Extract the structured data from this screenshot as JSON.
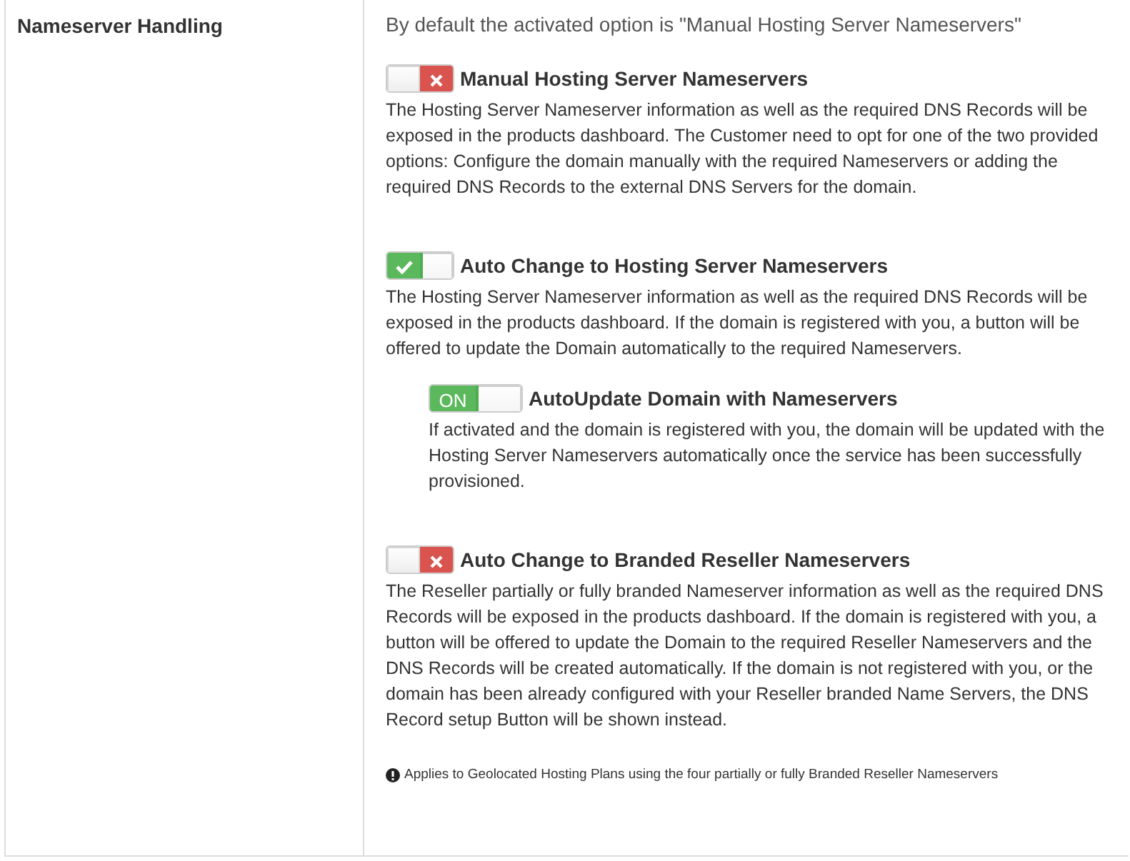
{
  "field": {
    "label": "Nameserver Handling"
  },
  "intro": "By default the activated option is \"Manual Hosting Server Nameservers\"",
  "options": [
    {
      "kind": "icon-toggle",
      "on": false,
      "title": "Manual Hosting Server Nameservers",
      "description": "The Hosting Server Nameserver information as well as the required DNS Records will be exposed in the products dashboard. The Customer need to opt for one of the two provided options: Configure the domain manually with the required Nameservers or adding the required DNS Records to the external DNS Servers for the domain."
    },
    {
      "kind": "icon-toggle",
      "on": true,
      "title": "Auto Change to Hosting Server Nameservers",
      "description": "The Hosting Server Nameserver information as well as the required DNS Records will be exposed in the products dashboard. If the domain is registered with you, a button will be offered to update the Domain automatically to the required Nameservers.",
      "children": [
        {
          "kind": "text-toggle",
          "on": true,
          "on_label": "ON",
          "title": "AutoUpdate Domain with Nameservers",
          "description": "If activated and the domain is registered with you, the domain will be updated with the Hosting Server Nameservers automatically once the service has been successfully provisioned."
        }
      ]
    },
    {
      "kind": "icon-toggle",
      "on": false,
      "title": "Auto Change to Branded Reseller Nameservers",
      "description": "The Reseller partially or fully branded Nameserver information as well as the required DNS Records will be exposed in the products dashboard. If the domain is registered with you, a button will be offered to update the Domain to the required Reseller Nameservers and the DNS Records will be created automatically. If the domain is not registered with you, or the domain has been already configured with your Reseller branded Name Servers, the DNS Record setup Button will be shown instead."
    }
  ],
  "note": "Applies to Geolocated Hosting Plans using the four partially or fully Branded Reseller Nameservers"
}
